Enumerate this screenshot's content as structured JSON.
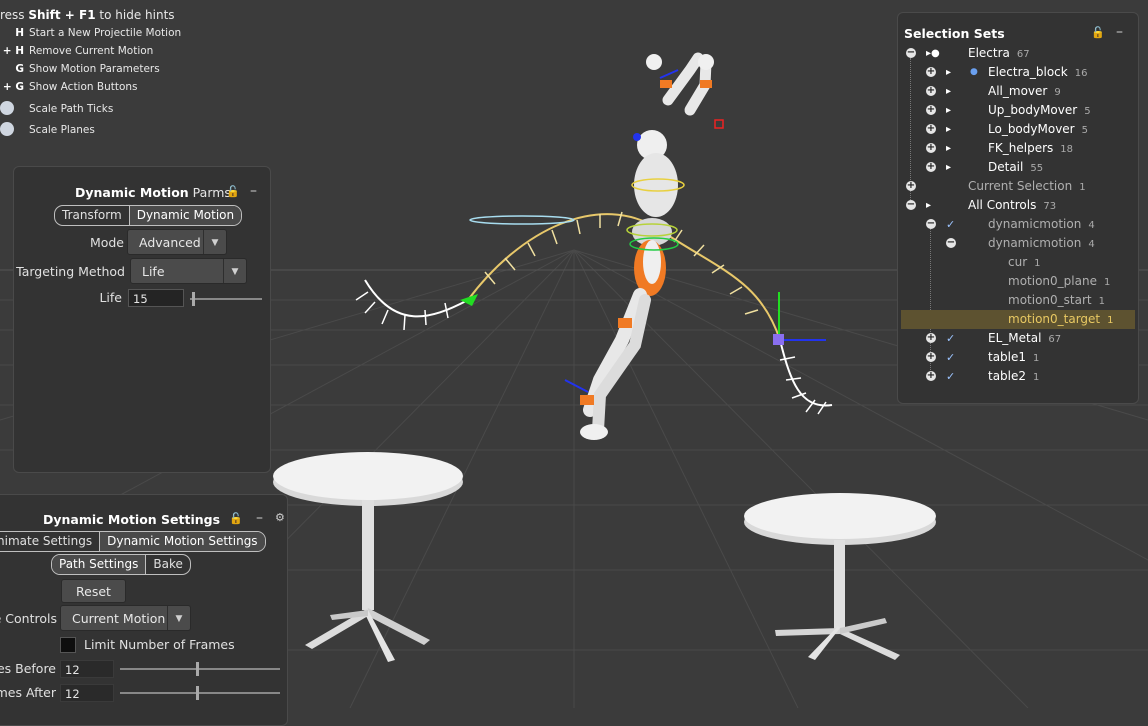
{
  "hints": {
    "title_prefix": "ress ",
    "title_key": "Shift + F1",
    "title_suffix": " to hide hints",
    "rows": [
      {
        "key": "H",
        "text": "Start a New Projectile Motion"
      },
      {
        "key": "+ H",
        "text": "Remove Current Motion"
      },
      {
        "key": "G",
        "text": "Show Motion Parameters"
      },
      {
        "key": "+ G",
        "text": "Show Action Buttons"
      },
      {
        "key": "",
        "text": "Scale Path Ticks"
      },
      {
        "key": "",
        "text": "Scale Planes"
      }
    ]
  },
  "parms_panel": {
    "title_bold": "Dynamic Motion",
    "title_rest": " Parms",
    "tabs": [
      "Transform",
      "Dynamic Motion"
    ],
    "mode_label": "Mode",
    "mode_value": "Advanced",
    "targeting_label": "Targeting Method",
    "targeting_value": "Life",
    "life_label": "Life",
    "life_value": "15"
  },
  "settings_panel": {
    "title": "Dynamic Motion Settings",
    "tabs": [
      "nimate Settings",
      "Dynamic Motion Settings"
    ],
    "subtabs": [
      "Path Settings",
      "Bake"
    ],
    "reset_label": "Reset",
    "controls_label": "e Controls",
    "controls_value": "Current Motion",
    "limit_label": "Limit Number of Frames",
    "frames_before_label": "es Before",
    "frames_before_value": "12",
    "frames_after_label": "mes After",
    "frames_after_value": "12"
  },
  "selection_sets": {
    "title": "Selection Sets",
    "items": [
      {
        "label": "Electra",
        "count": "67"
      },
      {
        "label": "Electra_block",
        "count": "16"
      },
      {
        "label": "All_mover",
        "count": "9"
      },
      {
        "label": "Up_bodyMover",
        "count": "5"
      },
      {
        "label": "Lo_bodyMover",
        "count": "5"
      },
      {
        "label": "FK_helpers",
        "count": "18"
      },
      {
        "label": "Detail",
        "count": "55"
      },
      {
        "label": "Current Selection",
        "count": "1"
      },
      {
        "label": "All Controls",
        "count": "73"
      },
      {
        "label": "dynamicmotion",
        "count": "4"
      },
      {
        "label": "dynamicmotion",
        "count": "4"
      },
      {
        "label": "cur",
        "count": "1"
      },
      {
        "label": "motion0_plane",
        "count": "1"
      },
      {
        "label": "motion0_start",
        "count": "1"
      },
      {
        "label": "motion0_target",
        "count": "1"
      },
      {
        "label": "EL_Metal",
        "count": "67"
      },
      {
        "label": "table1",
        "count": "1"
      },
      {
        "label": "table2",
        "count": "1"
      }
    ]
  },
  "colors": {
    "background": "#3b3b3b",
    "path": "#e8c86a",
    "highlight": "#e8c862",
    "robot_accent": "#f07a24"
  }
}
